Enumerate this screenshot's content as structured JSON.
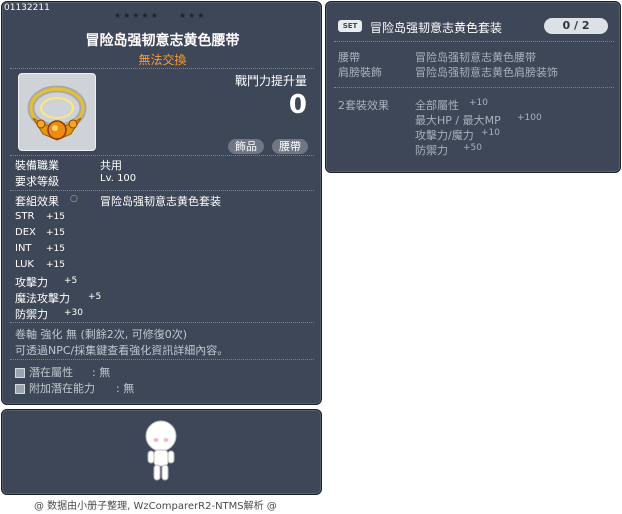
{
  "item": {
    "id": "01132211",
    "name": "冒险岛强韧意志黄色腰带",
    "untradeable": "無法交換",
    "combat_power_label": "戰鬥力提升量",
    "combat_power_value": "0",
    "tags": [
      "飾品",
      "腰帶"
    ],
    "requirements": [
      {
        "label": "裝備職業",
        "value": "共用"
      },
      {
        "label": "要求等級",
        "value": "Lv. 100"
      }
    ],
    "set_effect_label": "套組效果",
    "set_effect_value": "冒险岛强韧意志黄色套装",
    "stats": [
      {
        "label": "STR",
        "value": "+15"
      },
      {
        "label": "DEX",
        "value": "+15"
      },
      {
        "label": "INT",
        "value": "+15"
      },
      {
        "label": "LUK",
        "value": "+15"
      },
      {
        "label": "攻擊力",
        "value": "+5"
      },
      {
        "label": "魔法攻擊力",
        "value": "+5"
      },
      {
        "label": "防禦力",
        "value": "+30"
      }
    ],
    "scroll_info": "卷軸 強化 無 (剩餘2次, 可修復0次)",
    "scroll_hint": "可透過NPC/採集鍵查看強化資訊詳細內容。",
    "potential_label": "潛在屬性",
    "potential_value": ": 無",
    "additional_potential_label": "附加潛在能力",
    "additional_potential_value": ": 無"
  },
  "set": {
    "badge": "SET",
    "name": "冒险岛强韧意志黄色套装",
    "count": "0 / 2",
    "parts": [
      {
        "slot": "腰帶",
        "item": "冒险岛强韧意志黄色腰带"
      },
      {
        "slot": "肩膀裝飾",
        "item": "冒险岛强韧意志黄色肩膀装饰"
      }
    ],
    "effect_label": "2套裝效果",
    "effects": [
      {
        "label": "全部屬性",
        "value": "+10"
      },
      {
        "label": "最大HP / 最大MP",
        "value": "+100"
      },
      {
        "label": "攻擊力/魔力",
        "value": "+10"
      },
      {
        "label": "防禦力",
        "value": "+50"
      }
    ]
  },
  "footer": "@ 数据由小册子整理, WzComparerR2-NTMS解析 @",
  "colors": {
    "panel_bg": "#3e4757",
    "untradeable": "#ff9a2a",
    "muted_text": "#c1c7d0"
  },
  "icons": [
    "belt-item-icon",
    "star-icon",
    "potential-square-icon",
    "avatar-character-icon",
    "lock-icon"
  ]
}
